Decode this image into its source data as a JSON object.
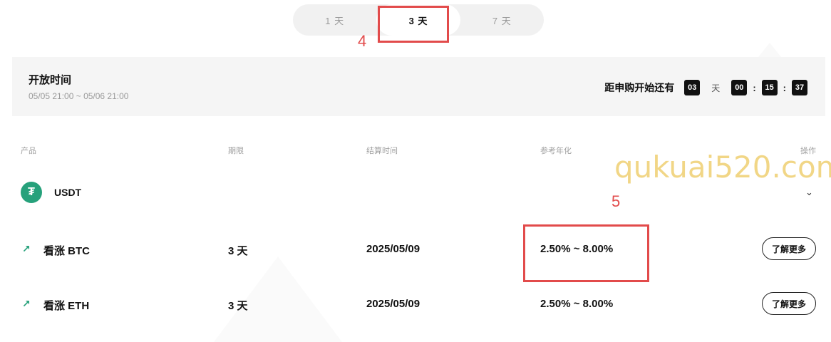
{
  "tabs": [
    {
      "label": "1 天"
    },
    {
      "label": "3 天"
    },
    {
      "label": "7 天"
    }
  ],
  "annotations": {
    "tab_marker": "4",
    "rate_marker": "5"
  },
  "window": {
    "title": "开放时间",
    "range": "05/05 21:00 ~ 05/06 21:00",
    "countdown_label": "距申购开始还有",
    "days": "03",
    "day_unit": "天",
    "hours": "00",
    "minutes": "15",
    "seconds": "37"
  },
  "table": {
    "headers": [
      "产品",
      "期限",
      "结算时间",
      "参考年化",
      "操作"
    ]
  },
  "group": {
    "coin": "USDT",
    "icon": "tether-icon",
    "color": "#26a17b"
  },
  "rows": [
    {
      "product": "看涨 BTC",
      "term": "3 天",
      "settle": "2025/05/09",
      "apr": "2.50% ~ 8.00%",
      "action": "了解更多"
    },
    {
      "product": "看涨 ETH",
      "term": "3 天",
      "settle": "2025/05/09",
      "apr": "2.50% ~ 8.00%",
      "action": "了解更多"
    }
  ],
  "watermark": "qukuai520.com"
}
